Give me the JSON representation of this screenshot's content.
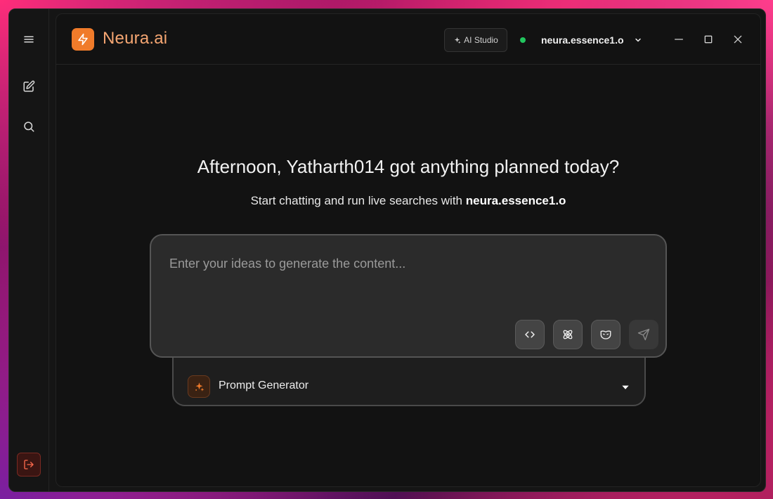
{
  "sidebar": {
    "menu_icon": "hamburger-icon",
    "new_chat_icon": "edit-icon",
    "search_icon": "search-icon",
    "logout_icon": "logout-icon"
  },
  "header": {
    "brand": "Neura.ai",
    "logo_icon": "lightning-icon",
    "studio_label": "AI Studio",
    "model_name": "neura.essence1.o",
    "status": "online",
    "status_color": "#22c55e",
    "accent_color": "#f07b2a"
  },
  "main": {
    "greeting": "Afternoon, Yatharth014 got anything planned today?",
    "subline_prefix": "Start chatting and run live searches with ",
    "subline_model": "neura.essence1.o",
    "composer": {
      "placeholder": "Enter your ideas to generate the content...",
      "value": "",
      "tools": [
        "code-icon",
        "atom-icon",
        "mask-icon"
      ],
      "send_icon": "send-icon"
    },
    "prompt_generator": {
      "label": "Prompt Generator",
      "icon": "sparkle-icon"
    }
  }
}
